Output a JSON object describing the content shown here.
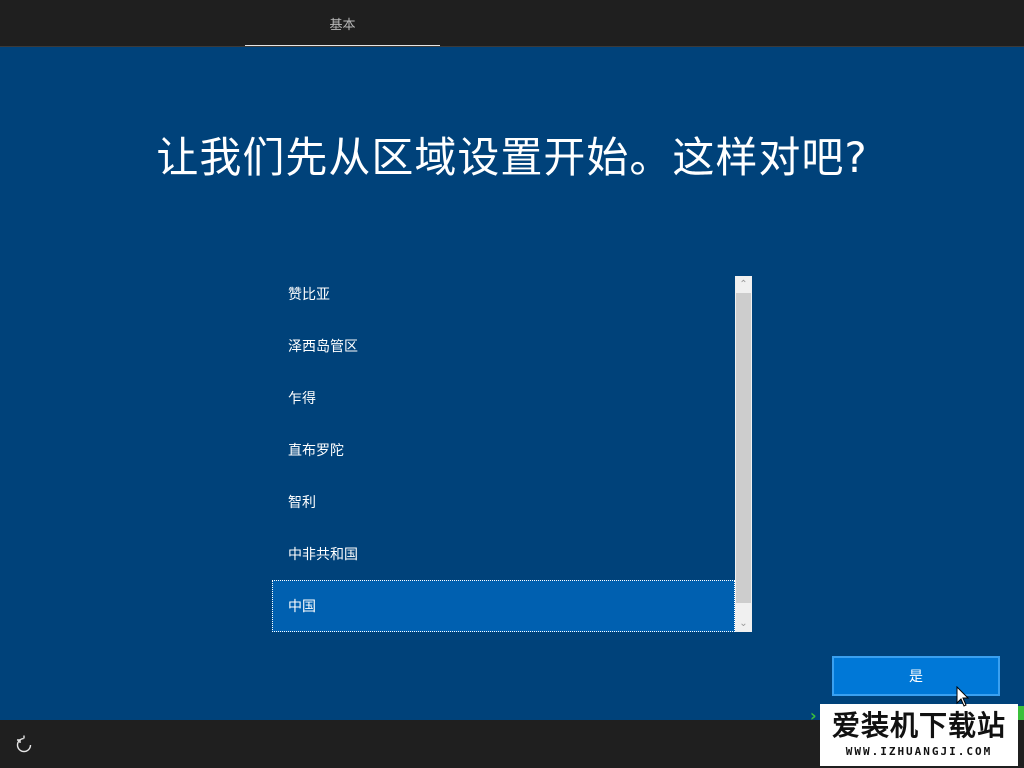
{
  "header": {
    "tab_label": "基本"
  },
  "main": {
    "heading": "让我们先从区域设置开始。这样对吧?",
    "region_list": {
      "items": [
        {
          "label": "赞比亚"
        },
        {
          "label": "泽西岛管区"
        },
        {
          "label": "乍得"
        },
        {
          "label": "直布罗陀"
        },
        {
          "label": "智利"
        },
        {
          "label": "中非共和国"
        },
        {
          "label": "中国",
          "selected": true
        }
      ]
    },
    "yes_button_label": "是"
  },
  "footer": {
    "accessibility_icon": "ease-of-access-icon"
  },
  "watermark": {
    "title": "爱装机下载站",
    "url": "WWW.IZHUANGJI.COM"
  },
  "colors": {
    "background": "#00427a",
    "bar": "#1f1f1f",
    "selected_item": "#0060b0",
    "button": "#0078d7"
  }
}
